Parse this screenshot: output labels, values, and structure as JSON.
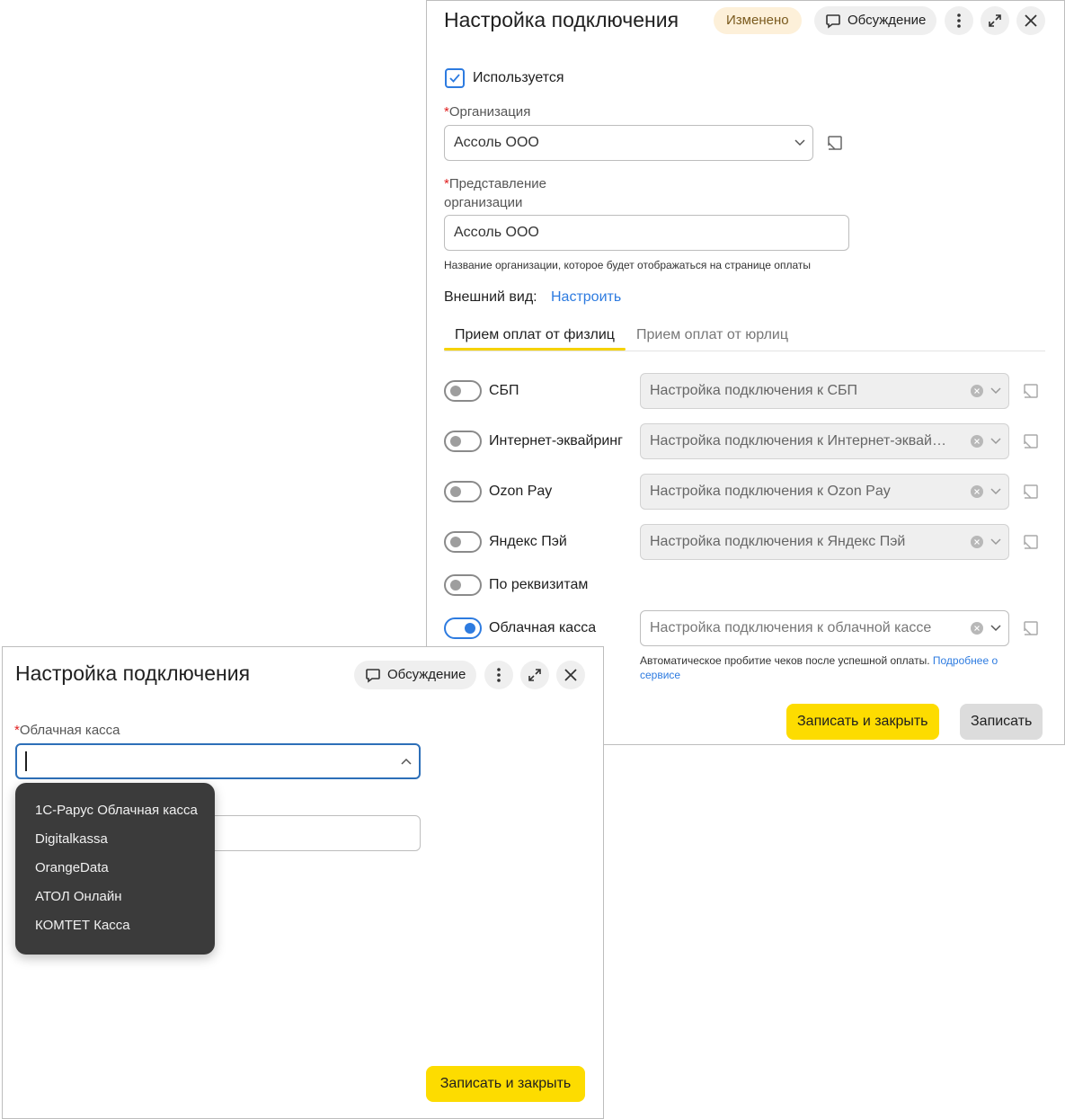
{
  "back_window": {
    "title": "Настройка подключения",
    "status_badge": "Изменено",
    "discussion_label": "Обсуждение",
    "used_checkbox_label": "Используется",
    "organization_label": "Организация",
    "organization_value": "Ассоль ООО",
    "representation_label_line1": "Представление",
    "representation_label_line2": "организации",
    "representation_value": "Ассоль ООО",
    "representation_hint": "Название организации, которое будет отображаться на странице оплаты",
    "appearance_label": "Внешний вид:",
    "appearance_link": "Настроить",
    "tabs": [
      {
        "label": "Прием оплат от физлиц",
        "active": true
      },
      {
        "label": "Прием оплат от юрлиц",
        "active": false
      }
    ],
    "payment_rows": [
      {
        "label": "СБП",
        "enabled": false,
        "field": "Настройка подключения к СБП"
      },
      {
        "label": "Интернет-эквайринг",
        "enabled": false,
        "field": "Настройка подключения к Интернет-эквай…"
      },
      {
        "label": "Ozon Pay",
        "enabled": false,
        "field": "Настройка подключения к Ozon Pay"
      },
      {
        "label": "Яндекс Пэй",
        "enabled": false,
        "field": "Настройка подключения к Яндекс Пэй"
      },
      {
        "label": "По реквизитам",
        "enabled": false,
        "field": ""
      },
      {
        "label": "Облачная касса",
        "enabled": true,
        "field": "Настройка подключения к облачной кассе"
      }
    ],
    "cloud_hint": "Автоматическое пробитие чеков после успешной оплаты.",
    "cloud_hint_link_line1": "Подробнее о",
    "cloud_hint_link_line2": "сервисе",
    "save_close_label": "Записать и закрыть",
    "save_label": "Записать"
  },
  "front_window": {
    "title": "Настройка подключения",
    "discussion_label": "Обсуждение",
    "cloud_field_label": "Облачная касса",
    "cloud_field_value": "",
    "dropdown_options": [
      "1С-Рарус Облачная касса",
      "Digitalkassa",
      "OrangeData",
      "АТОЛ Онлайн",
      "КОМТЕТ Касса"
    ],
    "save_close_label": "Записать и закрыть"
  },
  "colors": {
    "accent_blue": "#2d7be0",
    "yellow_button": "#fddc00",
    "badge_bg": "#fdf0d9",
    "required_star": "#e02020"
  }
}
